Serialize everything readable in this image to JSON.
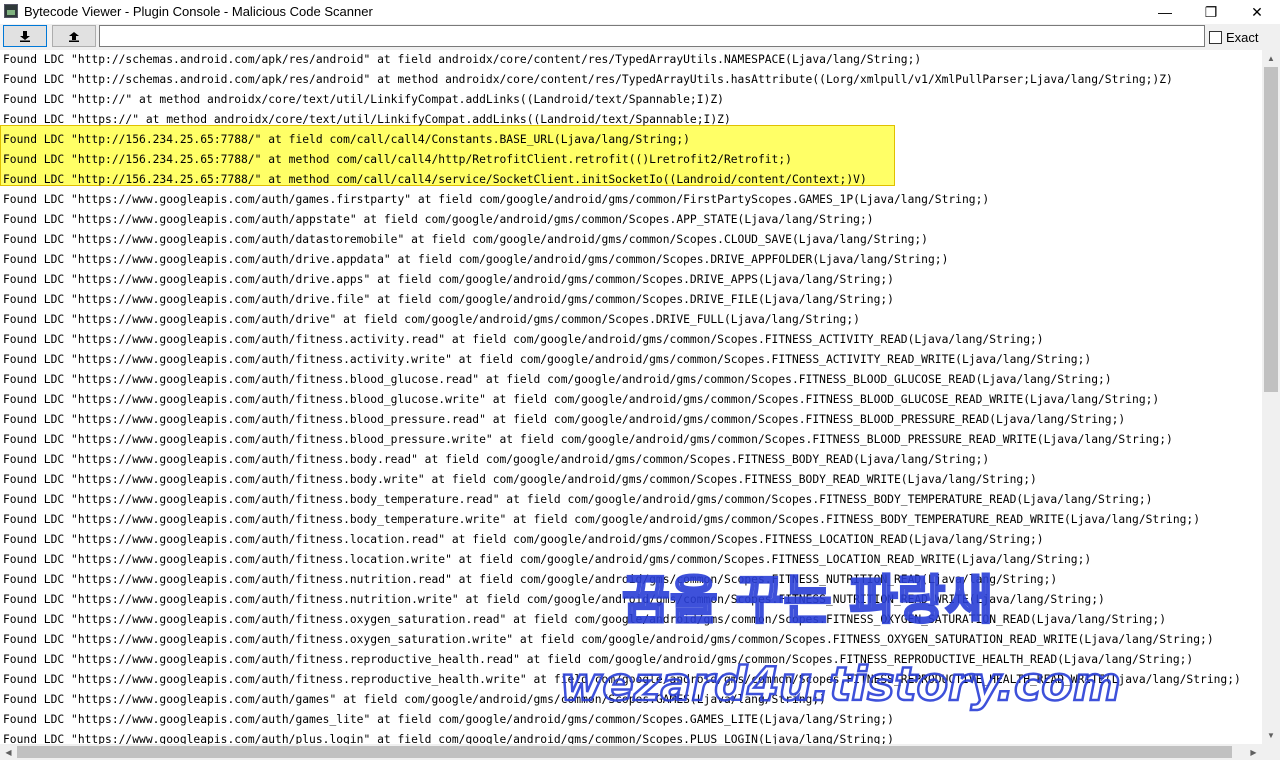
{
  "window": {
    "title": "Bytecode Viewer - Plugin Console - Malicious Code Scanner",
    "minimize": "—",
    "maximize": "❐",
    "close": "✕"
  },
  "toolbar": {
    "search_value": "",
    "exact_label": "Exact",
    "exact_checked": false
  },
  "console": {
    "highlighted_lines": [
      5,
      6,
      7
    ],
    "lines": [
      "Found LDC \"http://schemas.android.com/apk/res/android\" at field androidx/core/content/res/TypedArrayUtils.NAMESPACE(Ljava/lang/String;)",
      "Found LDC \"http://schemas.android.com/apk/res/android\" at method androidx/core/content/res/TypedArrayUtils.hasAttribute((Lorg/xmlpull/v1/XmlPullParser;Ljava/lang/String;)Z)",
      "Found LDC \"http://\" at method androidx/core/text/util/LinkifyCompat.addLinks((Landroid/text/Spannable;I)Z)",
      "Found LDC \"https://\" at method androidx/core/text/util/LinkifyCompat.addLinks((Landroid/text/Spannable;I)Z)",
      "Found LDC \"http://156.234.25.65:7788/\" at field com/call/call4/Constants.BASE_URL(Ljava/lang/String;)",
      "Found LDC \"http://156.234.25.65:7788/\" at method com/call/call4/http/RetrofitClient.retrofit(()Lretrofit2/Retrofit;)",
      "Found LDC \"http://156.234.25.65:7788/\" at method com/call/call4/service/SocketClient.initSocketIo((Landroid/content/Context;)V)",
      "Found LDC \"https://www.googleapis.com/auth/games.firstparty\" at field com/google/android/gms/common/FirstPartyScopes.GAMES_1P(Ljava/lang/String;)",
      "Found LDC \"https://www.googleapis.com/auth/appstate\" at field com/google/android/gms/common/Scopes.APP_STATE(Ljava/lang/String;)",
      "Found LDC \"https://www.googleapis.com/auth/datastoremobile\" at field com/google/android/gms/common/Scopes.CLOUD_SAVE(Ljava/lang/String;)",
      "Found LDC \"https://www.googleapis.com/auth/drive.appdata\" at field com/google/android/gms/common/Scopes.DRIVE_APPFOLDER(Ljava/lang/String;)",
      "Found LDC \"https://www.googleapis.com/auth/drive.apps\" at field com/google/android/gms/common/Scopes.DRIVE_APPS(Ljava/lang/String;)",
      "Found LDC \"https://www.googleapis.com/auth/drive.file\" at field com/google/android/gms/common/Scopes.DRIVE_FILE(Ljava/lang/String;)",
      "Found LDC \"https://www.googleapis.com/auth/drive\" at field com/google/android/gms/common/Scopes.DRIVE_FULL(Ljava/lang/String;)",
      "Found LDC \"https://www.googleapis.com/auth/fitness.activity.read\" at field com/google/android/gms/common/Scopes.FITNESS_ACTIVITY_READ(Ljava/lang/String;)",
      "Found LDC \"https://www.googleapis.com/auth/fitness.activity.write\" at field com/google/android/gms/common/Scopes.FITNESS_ACTIVITY_READ_WRITE(Ljava/lang/String;)",
      "Found LDC \"https://www.googleapis.com/auth/fitness.blood_glucose.read\" at field com/google/android/gms/common/Scopes.FITNESS_BLOOD_GLUCOSE_READ(Ljava/lang/String;)",
      "Found LDC \"https://www.googleapis.com/auth/fitness.blood_glucose.write\" at field com/google/android/gms/common/Scopes.FITNESS_BLOOD_GLUCOSE_READ_WRITE(Ljava/lang/String;)",
      "Found LDC \"https://www.googleapis.com/auth/fitness.blood_pressure.read\" at field com/google/android/gms/common/Scopes.FITNESS_BLOOD_PRESSURE_READ(Ljava/lang/String;)",
      "Found LDC \"https://www.googleapis.com/auth/fitness.blood_pressure.write\" at field com/google/android/gms/common/Scopes.FITNESS_BLOOD_PRESSURE_READ_WRITE(Ljava/lang/String;)",
      "Found LDC \"https://www.googleapis.com/auth/fitness.body.read\" at field com/google/android/gms/common/Scopes.FITNESS_BODY_READ(Ljava/lang/String;)",
      "Found LDC \"https://www.googleapis.com/auth/fitness.body.write\" at field com/google/android/gms/common/Scopes.FITNESS_BODY_READ_WRITE(Ljava/lang/String;)",
      "Found LDC \"https://www.googleapis.com/auth/fitness.body_temperature.read\" at field com/google/android/gms/common/Scopes.FITNESS_BODY_TEMPERATURE_READ(Ljava/lang/String;)",
      "Found LDC \"https://www.googleapis.com/auth/fitness.body_temperature.write\" at field com/google/android/gms/common/Scopes.FITNESS_BODY_TEMPERATURE_READ_WRITE(Ljava/lang/String;)",
      "Found LDC \"https://www.googleapis.com/auth/fitness.location.read\" at field com/google/android/gms/common/Scopes.FITNESS_LOCATION_READ(Ljava/lang/String;)",
      "Found LDC \"https://www.googleapis.com/auth/fitness.location.write\" at field com/google/android/gms/common/Scopes.FITNESS_LOCATION_READ_WRITE(Ljava/lang/String;)",
      "Found LDC \"https://www.googleapis.com/auth/fitness.nutrition.read\" at field com/google/android/gms/common/Scopes.FITNESS_NUTRITION_READ(Ljava/lang/String;)",
      "Found LDC \"https://www.googleapis.com/auth/fitness.nutrition.write\" at field com/google/android/gms/common/Scopes.FITNESS_NUTRITION_READ_WRITE(Ljava/lang/String;)",
      "Found LDC \"https://www.googleapis.com/auth/fitness.oxygen_saturation.read\" at field com/google/android/gms/common/Scopes.FITNESS_OXYGEN_SATURATION_READ(Ljava/lang/String;)",
      "Found LDC \"https://www.googleapis.com/auth/fitness.oxygen_saturation.write\" at field com/google/android/gms/common/Scopes.FITNESS_OXYGEN_SATURATION_READ_WRITE(Ljava/lang/String;)",
      "Found LDC \"https://www.googleapis.com/auth/fitness.reproductive_health.read\" at field com/google/android/gms/common/Scopes.FITNESS_REPRODUCTIVE_HEALTH_READ(Ljava/lang/String;)",
      "Found LDC \"https://www.googleapis.com/auth/fitness.reproductive_health.write\" at field com/google/android/gms/common/Scopes.FITNESS_REPRODUCTIVE_HEALTH_READ_WRITE(Ljava/lang/String;)",
      "Found LDC \"https://www.googleapis.com/auth/games\" at field com/google/android/gms/common/Scopes.GAMES(Ljava/lang/String;)",
      "Found LDC \"https://www.googleapis.com/auth/games_lite\" at field com/google/android/gms/common/Scopes.GAMES_LITE(Ljava/lang/String;)",
      "Found LDC \"https://www.googleapis.com/auth/plus.login\" at field com/google/android/gms/common/Scopes.PLUS_LOGIN(Ljava/lang/String;)"
    ]
  },
  "watermark": {
    "line1": "꿈을 꾸는 파랑새",
    "line2": "wezard4u.tistory.com",
    "color": "#2a3fd6"
  }
}
